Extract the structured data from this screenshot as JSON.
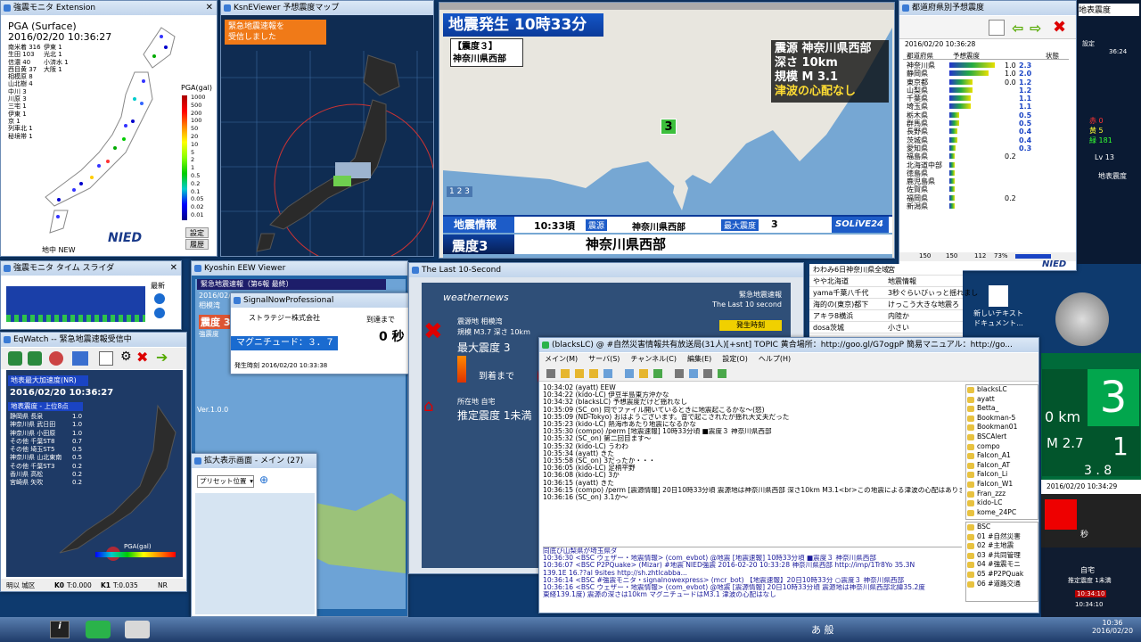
{
  "kmoni": {
    "title": "強震モニタ Extension",
    "heading": "PGA (Surface)",
    "datetime": "2016/02/20 10:36:27",
    "stations": [
      "南米着 316",
      "生田 103",
      "信濃 40",
      "西目黄 37",
      "相模原 8",
      "山北樹 4",
      "中川 3",
      "川原 3",
      "三宅 1",
      "伊東 1",
      "京 1",
      "列車北 1",
      "秘境帯 1"
    ],
    "stations2": [
      "伊東 1",
      "光北 1",
      "小済水 1",
      "大阪 1"
    ],
    "legend_title": "PGA(gal)",
    "legend": [
      "1000",
      "500",
      "200",
      "100",
      "50",
      "20",
      "10",
      "5",
      "2",
      "1",
      "0.5",
      "0.2",
      "0.1",
      "0.05",
      "0.02",
      "0.01"
    ],
    "footer": "地中 NEW",
    "btn1": "設定",
    "btn2": "履歴",
    "logo": "NIED"
  },
  "ksne": {
    "title": "KsnEViewer 予想震度マップ",
    "alert": "緊急地震速報を\n受信しました"
  },
  "tv": {
    "header": "地震発生 10時33分",
    "intensity_box": "【震度３】",
    "region_box": "神奈川県西部",
    "info": [
      "震源 神奈川県西部",
      "深さ 10km",
      "規模 M 3.1",
      "津波の心配なし"
    ],
    "marker": "3",
    "bar_title": "地震情報",
    "bar_time": "10:33頃",
    "bar_label": "震源",
    "bar_place": "神奈川県西部",
    "bar_label2": "最大震度",
    "bar_value": "3",
    "brand": "SOLiVE24",
    "bottom_int": "震度3",
    "bottom_place": "神奈川県西部",
    "legend": "1 2 3"
  },
  "pref": {
    "title": "都道府県別予想震度",
    "datetime": "2016/02/20 10:36:28",
    "headers": [
      "都道府県",
      "予想震度",
      "状態"
    ],
    "rows": [
      [
        "神奈川県",
        "1.0",
        "2.3"
      ],
      [
        "静岡県",
        "1.0",
        "2.0"
      ],
      [
        "東京都",
        "0.0",
        "1.2"
      ],
      [
        "山梨県",
        "",
        "1.2"
      ],
      [
        "千葉県",
        "",
        "1.1"
      ],
      [
        "埼玉県",
        "",
        "1.1"
      ],
      [
        "栃木県",
        "",
        "0.5"
      ],
      [
        "群馬県",
        "",
        "0.5"
      ],
      [
        "長野県",
        "",
        "0.4"
      ],
      [
        "茨城県",
        "",
        "0.4"
      ],
      [
        "愛知県",
        "",
        "0.3"
      ],
      [
        "福島県",
        "0.2",
        ""
      ],
      [
        "北海道中部",
        "",
        ""
      ],
      [
        "徳島県",
        "",
        ""
      ],
      [
        "鹿児島県",
        "",
        ""
      ],
      [
        "佐賀県",
        "",
        ""
      ],
      [
        "福岡県",
        "0.2",
        ""
      ],
      [
        "新潟県",
        "",
        ""
      ]
    ],
    "footer": [
      "150",
      "150",
      "112",
      "73%"
    ],
    "logo": "NIED"
  },
  "slider": {
    "title": "強震モニタ タイム スライダ",
    "label": "最新"
  },
  "eq": {
    "title": "EqWatch -- 緊急地震速報受信中",
    "banner": "地表最大加速度(NR)",
    "datetime": "2016/02/20 10:36:27",
    "sub": "地表震度 - 上位8点",
    "rows": [
      [
        "静岡県 長泉",
        "1.0"
      ],
      [
        "神奈川県 武日田",
        "1.0"
      ],
      [
        "神奈川県 小田原",
        "1.0"
      ],
      [
        "その他 千葉ST8",
        "0.7"
      ],
      [
        "その他 埼玉ST5",
        "0.5"
      ],
      [
        "神奈川県 山北東南",
        "0.5"
      ],
      [
        "その他 千葉ST3",
        "0.2"
      ],
      [
        "香川県 高松",
        "0.2"
      ],
      [
        "宮崎県 矢吹",
        "0.2"
      ]
    ],
    "legend": "PGA(gal)",
    "footer": [
      "明以 城区",
      "K0",
      "T:0.000",
      "K1",
      "T:0.035",
      "NR"
    ]
  },
  "kyoshin": {
    "title": "Kyoshin EEW Viewer",
    "banner": "緊急地震速報（第6報 最終）",
    "date": "2016/02/20",
    "place": "相模湾",
    "intensity": "震度 3",
    "label": "強震度"
  },
  "sn": {
    "title": "SignalNowProfessional",
    "company": "ストラテジー株式会社",
    "arrival": "到達まで",
    "seconds": "0 秒",
    "magnitude": "マグニチュード：３．７",
    "time": "発生時刻 2016/02/20 10:33:38",
    "ver": "Ver.1.0.0"
  },
  "zoom": {
    "title": "拡大表示画面 - メイン (27)",
    "preset": "プリセット位置"
  },
  "wn": {
    "title": "The Last 10-Second",
    "brand": "weathernews",
    "header_right": "緊急地震速報",
    "header_sub": "The Last 10 second",
    "occurred": "発生時刻",
    "epic_label": "震源地 相模湾",
    "mag": "規模 M3.7 深さ 10km",
    "max": "最大震度 3",
    "arrive": "到着まで",
    "loc": "所在地 自宅",
    "est": "推定震度 1未満"
  },
  "chat": {
    "title": "(blacksLC) @ #自然災害情報共有放送局(31人)[+snt] TOPIC 黄合場所：http://goo.gl/G7ogpP 簡易マニュアル：http://go...",
    "menu": [
      "メイン(M)",
      "サーバ(S)",
      "チャンネル(C)",
      "編集(E)",
      "設定(O)",
      "ヘルプ(H)"
    ],
    "lines": [
      "10:34:02 (ayatt) EEW",
      "10:34:22 (kido-LC) 伊豆半島東方沖かな",
      "10:34:32 (blacksLC) 予想震度だけど揺れなし",
      "10:35:09 (SC_on) 同でファイル開いているときに地震起こるかな〜(怒)",
      "10:35:09 (ND-Tokyo) おはようございます。音で起こされたが揺れ大丈夫だった",
      "10:35:23 (kido-LC) 熱海市あたり地震になるかな",
      "10:35:30 (compo) /perm [地震速報] 10時33分頃 ■震度３ 神奈川県西部",
      "10:35:32 (SC_on) 第二回目ます〜",
      "10:35:32 (kido-LC) うわわ",
      "10:35:34 (ayatt) きた",
      "10:35:58 (SC_on) 3だったか・・・",
      "10:36:05 (kido-LC) 足柄平野",
      "10:36:08 (kido-LC) 3か",
      "10:36:15 (ayatt) きた",
      "10:36:15 (compo) /perm [震源情報] 20日10時33分頃 震源地は神奈川県西部 深さ10km M3.1<br>この地震による津波の心配はありません",
      "10:36:16 (SC_on) 3.1か〜"
    ],
    "lines2": [
      "同底び山梨県が埼玉県ダ",
      "10:36:30 <BSC ウェザー・地震情報> (com_evbot) @地震 [地震速報] 10時33分頃 ■震度３ 神奈川県西部",
      "10:36:07 <BSC P2PQuake> (Mizar) #地震 NIED強震 2016-02-20 10:33:28 神奈川県西部 http://imp/1Tr8Yo 35.3N",
      "139.1E 16.??al 9sites http://sh.zhtlcabba...",
      "10:36:14 <BSC #強震モニタ・signalnowexpress> (mcr_bot) 【地震速報】20日10時33分 ○震度３ 神奈川県西部",
      "10:36:16 <BSC ウェザー・地震情報> (com_evbot) @地震 [震源情報] 20日10時33分頃 震源地は神奈川県西部北緯35.2度",
      "東経139.1度) 震源の深さは10km マグニチュードはM3.1 津波の心配はなし"
    ],
    "users": [
      "blacksLC",
      "ayatt",
      "Betta_",
      "Bookman-5",
      "Bookman01",
      "BSCAlert",
      "compo",
      "Falcon_A1",
      "Falcon_AT",
      "Falcon_Li",
      "Falcon_W1",
      "Fran_zzz",
      "kido-LC",
      "kome_24PC"
    ],
    "channels": [
      "BSC",
      "01 #自然災害",
      "02 #主地震",
      "03 #共同管理",
      "04 #強震モニ",
      "05 #P2PQuak",
      "06 #道路交通"
    ]
  },
  "feed": {
    "rows": [
      [
        "わわみ6日神奈川県全域",
        "宮"
      ],
      [
        "やや北海道",
        "地震情報"
      ],
      [
        "yama千葉八千代",
        "3秒ぐらいびぃっと揺れまし"
      ],
      [
        "海的の(東京)都下",
        "けっこう大きな地震ろ"
      ],
      [
        "アキラ8横浜",
        "内陸か"
      ],
      [
        "dosa茨城",
        "小さい"
      ]
    ]
  },
  "right": {
    "lv": "Lv 13",
    "labels": [
      "赤 0",
      "黄 5",
      "緑 181"
    ],
    "big": "3",
    "km": "0 km",
    "mag": "M 2.7",
    "mag2": "1",
    "num": "3 . 8",
    "date": "2016/02/20 10:34:29",
    "sec": "秒",
    "home": "自宅",
    "home2": "推定震度 1未満",
    "t1": "10:34:10",
    "t2": "10:34:10",
    "region": "地表震度",
    "set": "設定",
    "cnt": "36:24"
  },
  "desktop": {
    "icon1": "新しいテキスト\nドキュメント..."
  },
  "clock": {
    "time": "10:36",
    "date": "2016/02/20"
  }
}
